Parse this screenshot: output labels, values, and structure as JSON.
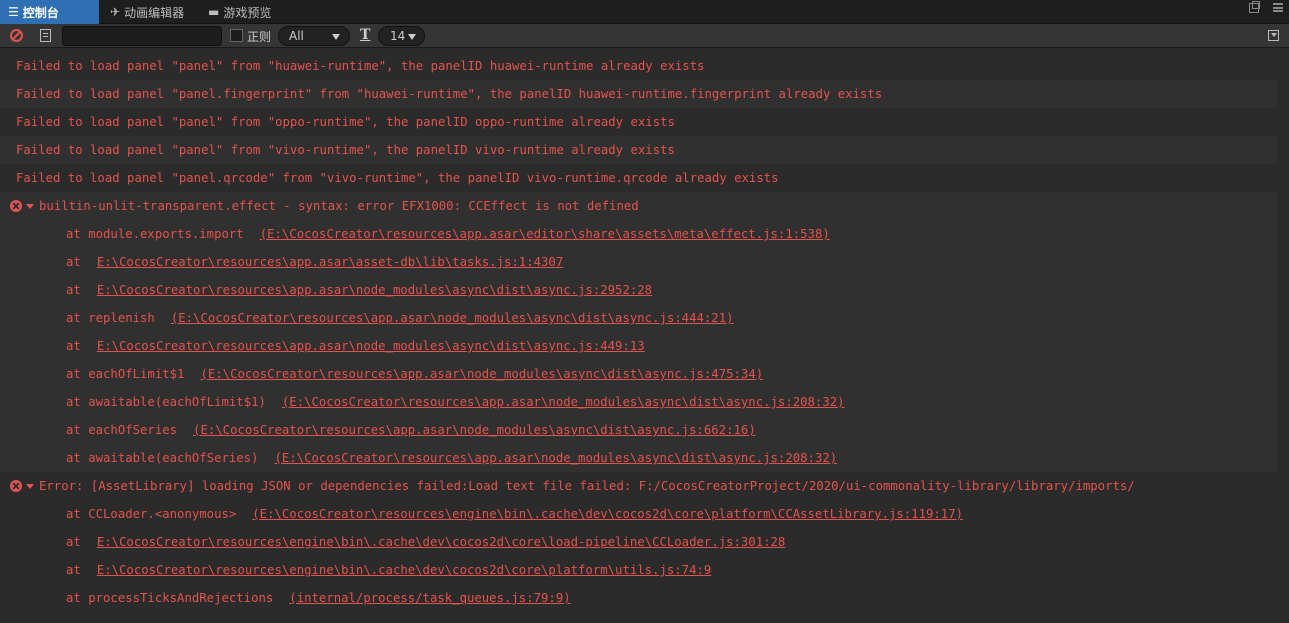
{
  "tabs": [
    {
      "label": "控制台",
      "icon": "console-icon"
    },
    {
      "label": "动画编辑器",
      "icon": "animation-icon"
    },
    {
      "label": "游戏预览",
      "icon": "preview-icon"
    }
  ],
  "toolbar": {
    "search_value": "",
    "regex_label": "正则",
    "filter_value": "All",
    "font_size": "14"
  },
  "logs": [
    "Failed to load panel \"panel\" from \"huawei-runtime\", the panelID huawei-runtime already exists",
    "Failed to load panel \"panel.fingerprint\" from \"huawei-runtime\", the panelID huawei-runtime.fingerprint already exists",
    "Failed to load panel \"panel\" from \"oppo-runtime\", the panelID oppo-runtime already exists",
    "Failed to load panel \"panel\" from \"vivo-runtime\", the panelID vivo-runtime already exists",
    "Failed to load panel \"panel.qrcode\" from \"vivo-runtime\", the panelID vivo-runtime.qrcode already exists"
  ],
  "errors": [
    {
      "message": "builtin-unlit-transparent.effect - syntax: error EFX1000: CCEffect is not defined",
      "stack": [
        {
          "at": "at module.exports.import",
          "link": "(E:\\CocosCreator\\resources\\app.asar\\editor\\share\\assets\\meta\\effect.js:1:538)"
        },
        {
          "at": "at",
          "link": "E:\\CocosCreator\\resources\\app.asar\\asset-db\\lib\\tasks.js:1:4307"
        },
        {
          "at": "at",
          "link": "E:\\CocosCreator\\resources\\app.asar\\node_modules\\async\\dist\\async.js:2952:28"
        },
        {
          "at": "at replenish",
          "link": "(E:\\CocosCreator\\resources\\app.asar\\node_modules\\async\\dist\\async.js:444:21)"
        },
        {
          "at": "at",
          "link": "E:\\CocosCreator\\resources\\app.asar\\node_modules\\async\\dist\\async.js:449:13"
        },
        {
          "at": "at eachOfLimit$1",
          "link": "(E:\\CocosCreator\\resources\\app.asar\\node_modules\\async\\dist\\async.js:475:34)"
        },
        {
          "at": "at awaitable(eachOfLimit$1)",
          "link": "(E:\\CocosCreator\\resources\\app.asar\\node_modules\\async\\dist\\async.js:208:32)"
        },
        {
          "at": "at eachOfSeries",
          "link": "(E:\\CocosCreator\\resources\\app.asar\\node_modules\\async\\dist\\async.js:662:16)"
        },
        {
          "at": "at awaitable(eachOfSeries)",
          "link": "(E:\\CocosCreator\\resources\\app.asar\\node_modules\\async\\dist\\async.js:208:32)"
        }
      ]
    },
    {
      "message": "Error: [AssetLibrary] loading JSON or dependencies failed:Load text file failed: F:/CocosCreatorProject/2020/ui-commonality-library/library/imports/",
      "stack": [
        {
          "at": "at CCLoader.<anonymous>",
          "link": "(E:\\CocosCreator\\resources\\engine\\bin\\.cache\\dev\\cocos2d\\core\\platform\\CCAssetLibrary.js:119:17)"
        },
        {
          "at": "at",
          "link": "E:\\CocosCreator\\resources\\engine\\bin\\.cache\\dev\\cocos2d\\core\\load-pipeline\\CCLoader.js:301:28"
        },
        {
          "at": "at",
          "link": "E:\\CocosCreator\\resources\\engine\\bin\\.cache\\dev\\cocos2d\\core\\platform\\utils.js:74:9"
        },
        {
          "at": "at processTicksAndRejections",
          "link": "(internal/process/task_queues.js:79:9)"
        }
      ]
    }
  ]
}
